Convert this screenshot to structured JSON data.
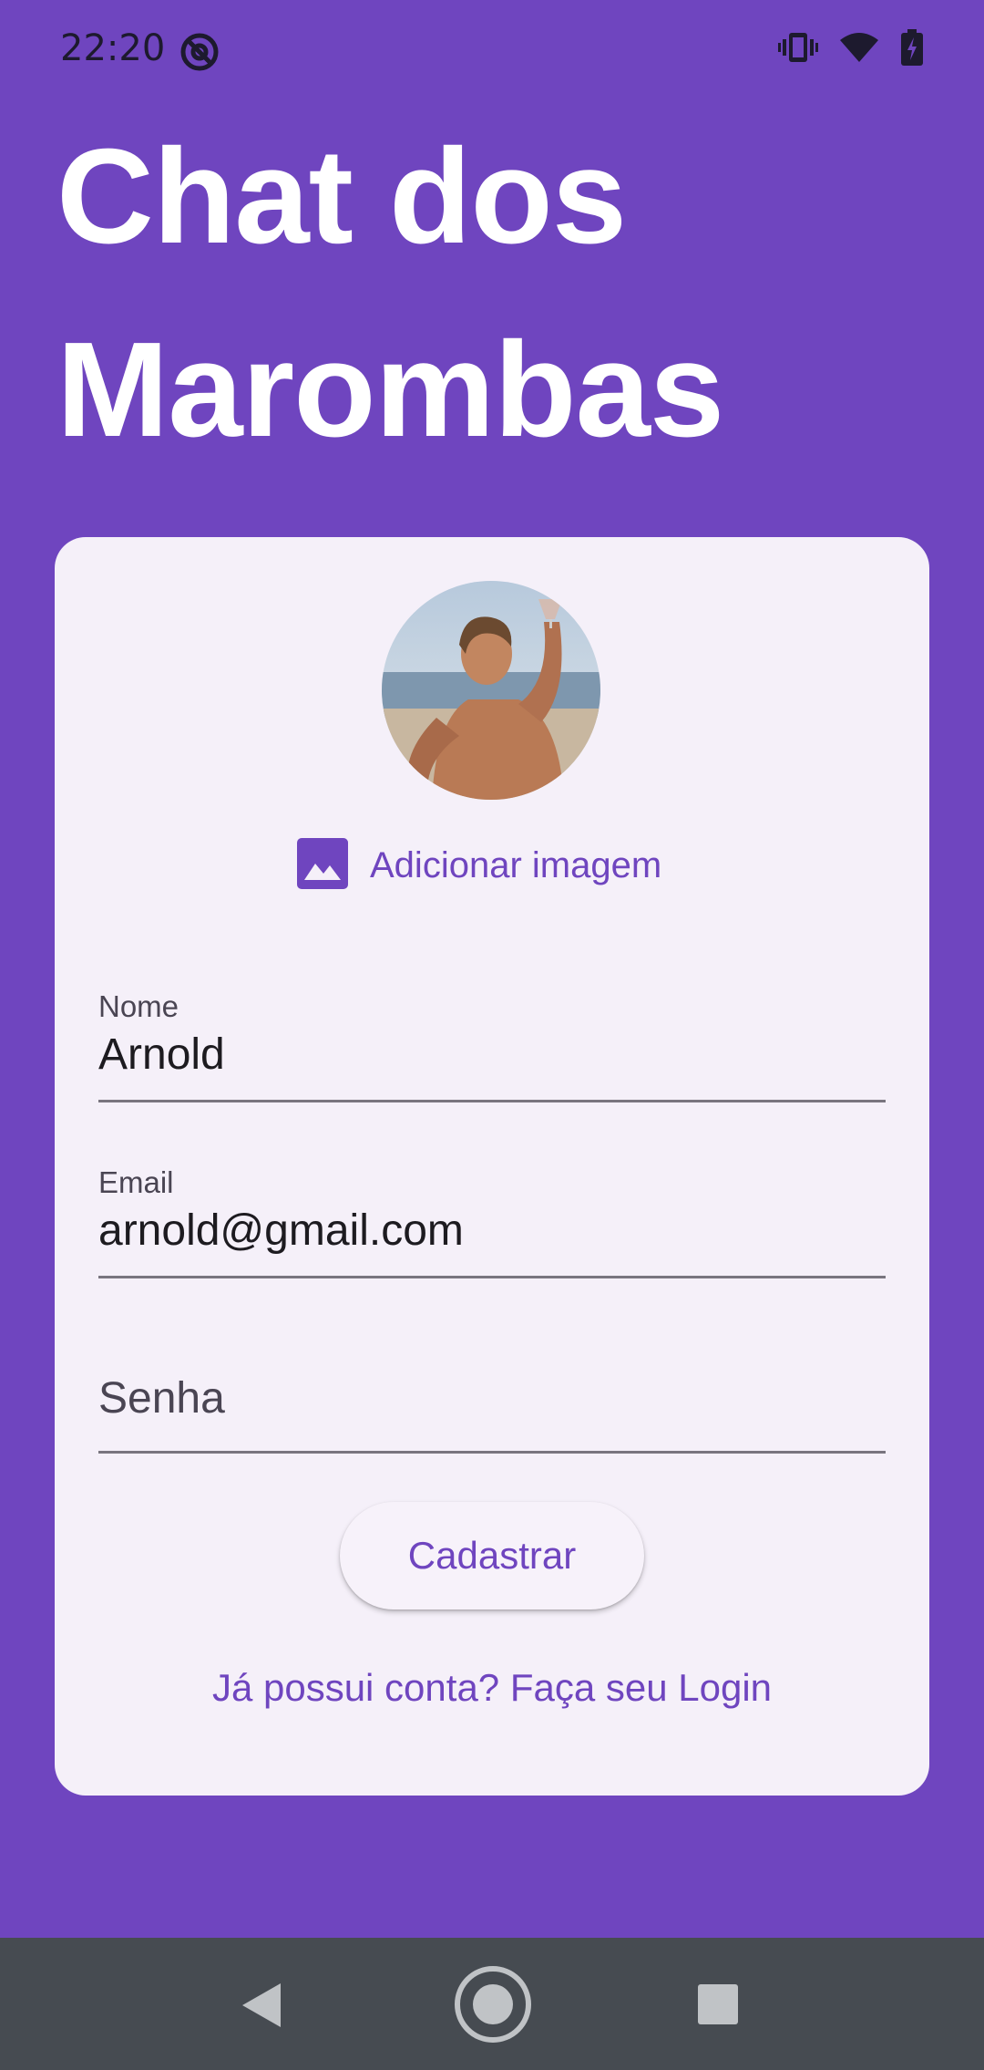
{
  "status_bar": {
    "time": "22:20"
  },
  "app": {
    "title": "Chat dos Marombas"
  },
  "form": {
    "add_image_label": "Adicionar imagem",
    "fields": {
      "name": {
        "label": "Nome",
        "value": "Arnold"
      },
      "email": {
        "label": "Email",
        "value": "arnold@gmail.com"
      },
      "password": {
        "label": "Senha",
        "value": ""
      }
    },
    "submit_label": "Cadastrar",
    "login_link": "Já possui conta? Faça seu Login"
  },
  "icons": {
    "status_left": "at-sign-icon",
    "vibrate": "vibrate-icon",
    "wifi": "wifi-icon",
    "battery": "battery-charging-icon",
    "add_image": "image-icon",
    "nav_back": "back-icon",
    "nav_home": "home-icon",
    "nav_recent": "recent-apps-icon"
  },
  "colors": {
    "primary": "#6f45bf",
    "card": "#f5f0f9",
    "nav_bar": "#464b51"
  }
}
